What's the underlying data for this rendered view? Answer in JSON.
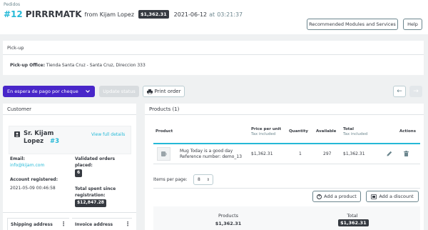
{
  "header": {
    "breadcrumb": "Pedidos",
    "order_id": "#12",
    "reference": "PIRRRMATK",
    "from_text": "from Kijam Lopez",
    "total_badge": "$1,362.31",
    "date": "2021-06-12",
    "at_text": "at",
    "time": "03:21:37",
    "recommended_modules_label": "Recommended Modules and Services",
    "help_label": "Help"
  },
  "pickup": {
    "title": "Pick-up",
    "office_label": "Pick-up Office:",
    "office_value": "Tienda Santa Cruz - Santa Cruz, Direccion 333"
  },
  "toolbar": {
    "status_value": "En espera de pago por cheque",
    "update_status_label": "Update status",
    "print_order_label": "Print order"
  },
  "customer": {
    "title": "Customer",
    "name": "Sr. Kijam Lopez",
    "name_line1": "Sr. Kijam",
    "name_line2": "Lopez",
    "customer_id": "#3",
    "view_full_details": "View full details",
    "email_label": "Email:",
    "email_value": "info@kijam.com",
    "validated_orders_label": "Validated orders placed:",
    "validated_orders_line1": "Validated orders",
    "validated_orders_line2": "placed:",
    "validated_orders_count": "6",
    "account_registered_label": "Account registered:",
    "account_registered_value": "2021-05-09 00:46:58",
    "total_spent_line1": "Total spent since",
    "total_spent_line2": "registration:",
    "total_spent_value": "$12,847.28",
    "shipping_address_label": "Shipping address",
    "invoice_address_label": "Invoice address"
  },
  "products": {
    "title": "Products (1)",
    "columns": {
      "product": "Product",
      "price_per_unit": "Price per unit",
      "quantity": "Quantity",
      "available": "Available",
      "total": "Total",
      "actions": "Actions",
      "tax_included": "Tax included"
    },
    "rows": [
      {
        "name": "Mug Today is a good day",
        "reference": "Reference number: demo_13",
        "price": "$1,362.31",
        "quantity": "1",
        "available": "297",
        "total": "$1,362.31"
      }
    ],
    "items_per_page_label": "Items per page:",
    "items_per_page_value": "8",
    "add_product_label": "Add a product",
    "add_discount_label": "Add a discount",
    "summary": {
      "products_label": "Products",
      "products_value": "$1,362.31",
      "total_label": "Total",
      "total_value": "$1,362.31"
    }
  },
  "colors": {
    "accent": "#25b9d7",
    "status_button": "#4826c9",
    "dark_badge": "#363a41",
    "background": "#eff1f2"
  }
}
